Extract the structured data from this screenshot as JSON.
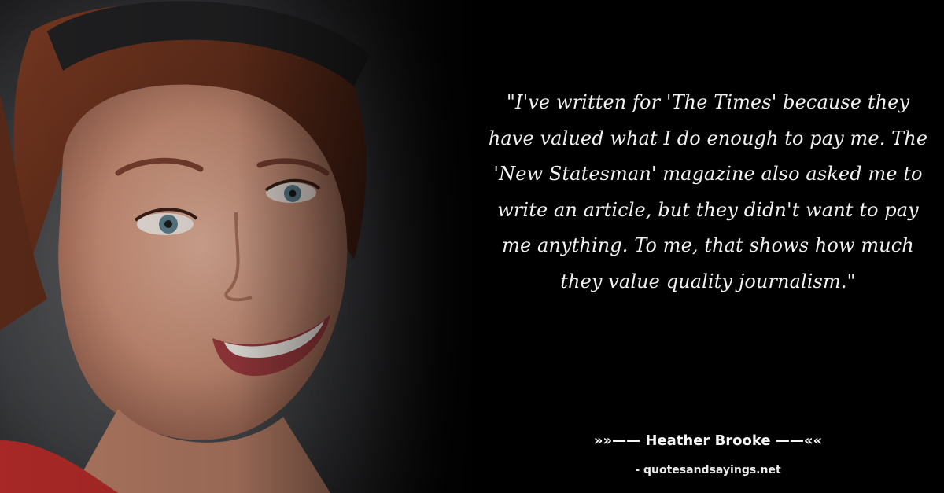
{
  "quote": {
    "text": "\"I've written for 'The Times' because they have valued what I do enough to pay me. The 'New Statesman' magazine also asked me to write an article, but they didn't want to pay me anything. To me, that shows how much they value quality journalism.\""
  },
  "attribution": {
    "author": "»»—— Heather Brooke ——««",
    "source": "- quotesandsayings.net"
  },
  "colors": {
    "background": "#000000",
    "text": "#f2f2f2"
  }
}
